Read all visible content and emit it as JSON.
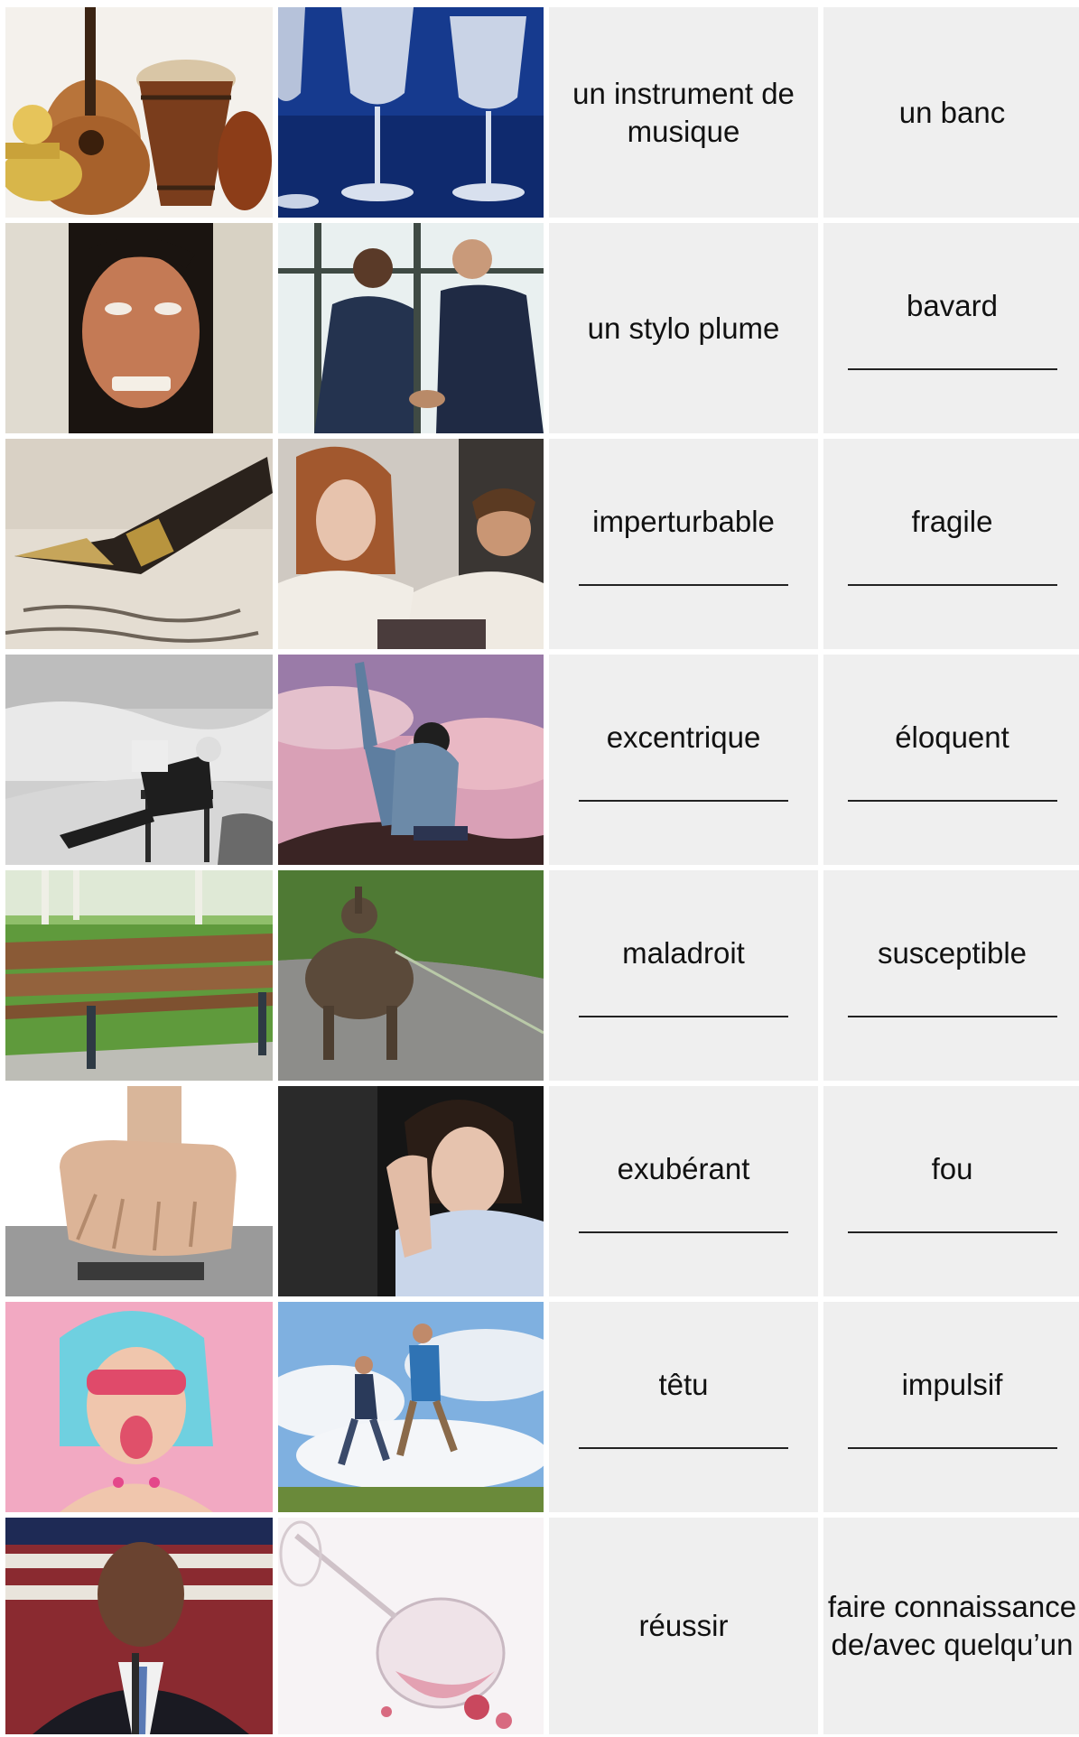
{
  "rows": [
    {
      "col3": "un instrument de musique",
      "col4": "un banc",
      "blank3": false,
      "blank4": false,
      "img1": "musical-instruments-image",
      "img2": "crystal-glasses-image"
    },
    {
      "col3": "un stylo plume",
      "col4": "bavard",
      "blank3": false,
      "blank4": true,
      "img1": "crazy-face-image",
      "img2": "handshake-image"
    },
    {
      "col3": "imperturbable",
      "col4": "fragile",
      "blank3": true,
      "blank4": true,
      "img1": "fountain-pen-image",
      "img2": "annoyed-woman-chatty-man-image"
    },
    {
      "col3": "excentrique",
      "col4": "éloquent",
      "blank3": true,
      "blank4": true,
      "img1": "man-reading-in-storm-image",
      "img2": "man-cheering-on-mountain-image"
    },
    {
      "col3": "maladroit",
      "col4": "susceptible",
      "blank3": true,
      "blank4": true,
      "img1": "park-bench-image",
      "img2": "stubborn-donkey-image"
    },
    {
      "col3": "exubérant",
      "col4": "fou",
      "blank3": true,
      "blank4": true,
      "img1": "clenched-fist-image",
      "img2": "sad-woman-image"
    },
    {
      "col3": "têtu",
      "col4": "impulsif",
      "blank3": true,
      "blank4": true,
      "img1": "exuberant-woman-image",
      "img2": "people-jumping-image"
    },
    {
      "col3": "réussir",
      "col4": "faire connaissance de/avec quelqu’un",
      "blank3": false,
      "blank4": false,
      "img1": "president-speaking-image",
      "img2": "spilled-wine-glass-image"
    }
  ]
}
